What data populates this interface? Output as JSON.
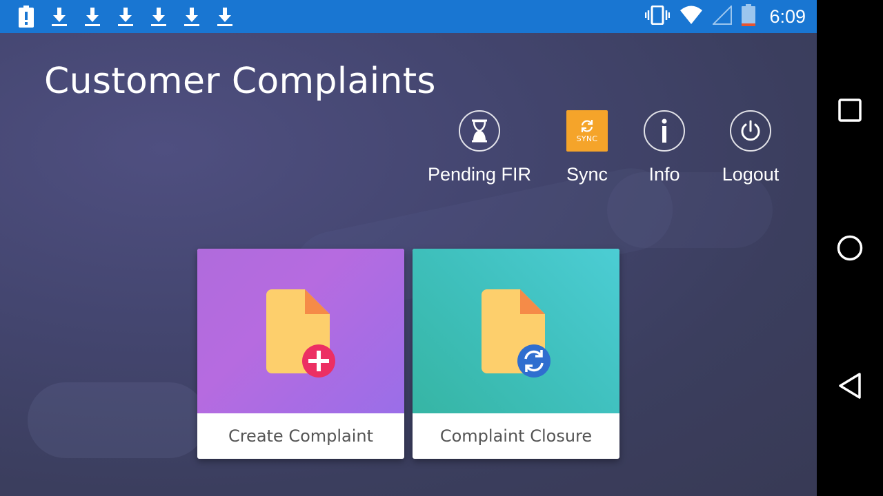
{
  "status_bar": {
    "time": "6:09",
    "left_icons": [
      "battery-alert-icon",
      "download-icon",
      "download-icon",
      "download-icon",
      "download-icon",
      "download-icon",
      "download-icon"
    ],
    "right_icons": [
      "vibrate-icon",
      "wifi-icon",
      "signal-icon",
      "battery-icon"
    ],
    "color": "#1976d2"
  },
  "header": {
    "title": "Customer Complaints"
  },
  "actions": [
    {
      "label": "Pending FIR",
      "icon": "hourglass-icon"
    },
    {
      "label": "Sync",
      "icon": "sync-icon",
      "badge_text": "SYNC",
      "color": "#f5a42a"
    },
    {
      "label": "Info",
      "icon": "info-icon"
    },
    {
      "label": "Logout",
      "icon": "power-icon"
    }
  ],
  "cards": [
    {
      "label": "Create Complaint",
      "icon": "add-document-icon"
    },
    {
      "label": "Complaint Closure",
      "icon": "refresh-document-icon"
    }
  ],
  "nav_bar": {
    "buttons": [
      "recents-icon",
      "home-icon",
      "back-icon"
    ]
  }
}
